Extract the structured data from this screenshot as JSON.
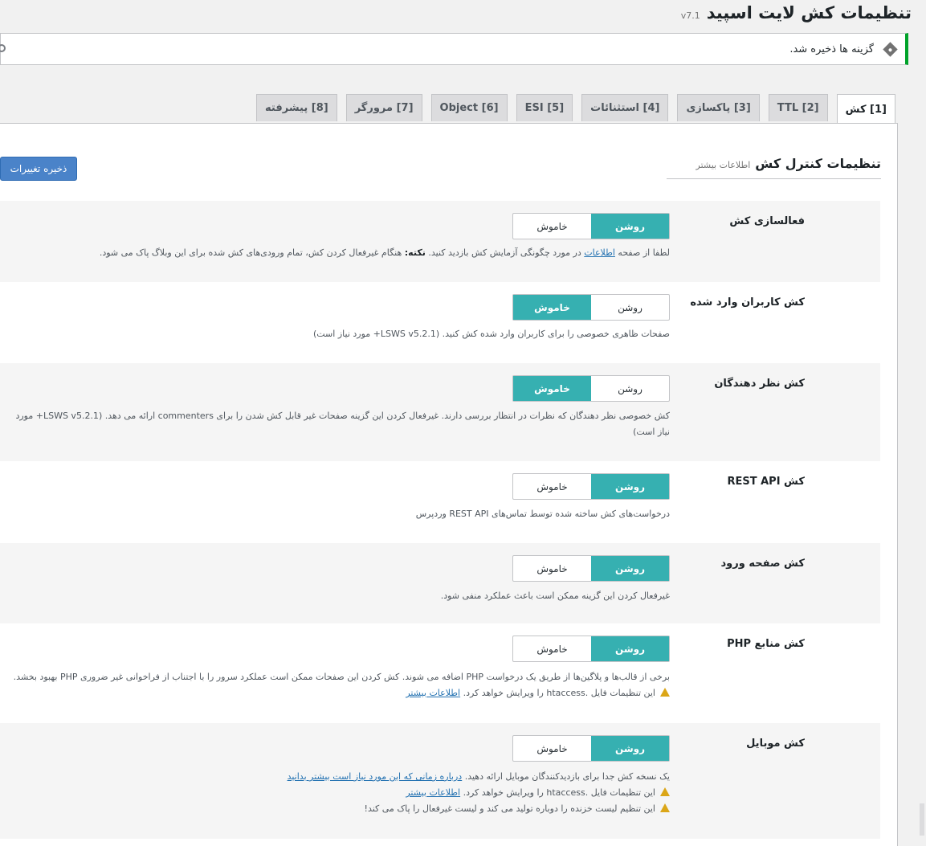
{
  "header": {
    "title": "تنظیمات کش لایت اسپید",
    "version": "v7.1"
  },
  "notice": {
    "message": "گزینه ها ذخیره شد."
  },
  "tabs": [
    {
      "label": "[1] کش",
      "active": true
    },
    {
      "label": "[2] TTL"
    },
    {
      "label": "[3] پاکسازی"
    },
    {
      "label": "[4] استثنائات"
    },
    {
      "label": "[5] ESI"
    },
    {
      "label": "[6] Object"
    },
    {
      "label": "[7] مرورگر"
    },
    {
      "label": "[8] پیشرفته"
    }
  ],
  "section": {
    "title": "تنظیمات کنترل کش",
    "more": "اطلاعات بیشتر",
    "save_label": "ذخیره تغییرات"
  },
  "toggle": {
    "on": "روشن",
    "off": "خاموش"
  },
  "settings": [
    {
      "label": "فعالسازی کش",
      "value": "on",
      "desc_a": "لطفا از صفحه ",
      "desc_link": "اطلاعات",
      "desc_b": " در مورد چگونگی آزمایش کش بازدید کنید. ",
      "desc_note": "نکته:",
      "desc_c": " هنگام غیرفعال کردن کش، تمام ورودی‌های کش شده برای این وبلاگ پاک می شود."
    },
    {
      "label": "کش کاربران وارد شده",
      "value": "off",
      "desc": "صفحات ظاهری خصوصی را برای کاربران وارد شده کش کنید. (LSWS v5.2.1+ مورد نیاز است)"
    },
    {
      "label": "کش نظر دهندگان",
      "value": "off",
      "desc": "کش خصوصی نظر دهندگان که نظرات در انتظار بررسی دارند. غیرفعال کردن این گزینه صفحات غیر قابل کش شدن را برای commenters ارائه می دهد. (LSWS v5.2.1+ مورد نیاز است)"
    },
    {
      "label": "کش REST API",
      "value": "on",
      "desc": "درخواست‌های کش ساخته شده توسط تماس‌های REST API وردپرس"
    },
    {
      "label": "کش صفحه ورود",
      "value": "on",
      "desc": "غیرفعال کردن این گزینه ممکن است باعث عملکرد منفی شود."
    },
    {
      "label": "کش منابع PHP",
      "value": "on",
      "desc": "برخی از قالب‌ها و پلاگین‌ها از طریق یک درخواست PHP اضافه می شوند. کش کردن این صفحات ممکن است عملکرد سرور را با اجتناب از فراخوانی غیر ضروری PHP بهبود بخشد.",
      "warn": "این تنظیمات فایل .htaccess را ویرایش خواهد کرد.",
      "warn_link": "اطلاعات بیشتر"
    },
    {
      "label": "کش موبایل",
      "value": "on",
      "desc": "یک نسخه کش جدا برای بازدیدکنندگان موبایل ارائه دهید.",
      "desc_link": "درباره زمانی که این مورد نیاز است بیشتر بدانید",
      "warn": "این تنظیمات فایل .htaccess را ویرایش خواهد کرد.",
      "warn_link": "اطلاعات بیشتر",
      "warn2": "این تنظیم لیست خزنده را دوباره تولید می کند و لیست غیرفعال را پاک می کند!"
    }
  ]
}
